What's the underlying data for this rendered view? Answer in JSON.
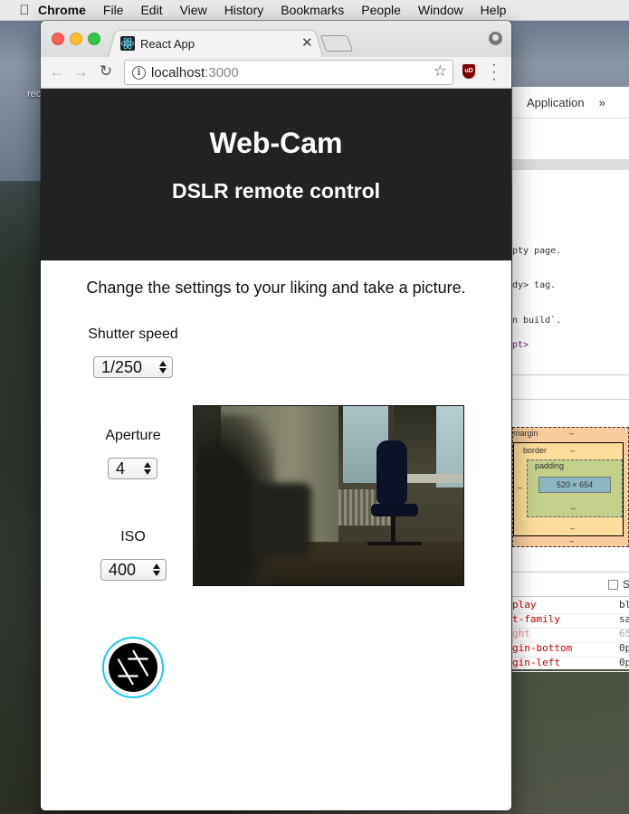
{
  "menubar": {
    "app": "Chrome",
    "items": [
      "File",
      "Edit",
      "View",
      "History",
      "Bookmarks",
      "People",
      "Window",
      "Help"
    ]
  },
  "desktop": {
    "cutoff_label": "rec"
  },
  "devtools": {
    "tab_label": "Application",
    "overflow": "»",
    "code_lines": [
      "pty page.",
      "dy> tag.",
      "n build`.",
      "pt>"
    ],
    "box_model": {
      "margin_label": "margin",
      "border_label": "border",
      "padding_label": "padding",
      "content_size": "520 × 654",
      "dash": "–"
    },
    "styles_checkbox_label": "S",
    "styles": [
      {
        "prop": "play",
        "val": "bl"
      },
      {
        "prop": "t-family",
        "val": "sa"
      },
      {
        "prop": "ght",
        "val": "65"
      },
      {
        "prop": "gin-bottom",
        "val": "0p"
      },
      {
        "prop": "gin-left",
        "val": "0p"
      }
    ]
  },
  "browser": {
    "tab_title": "React App",
    "url_host": "localhost",
    "url_port": ":3000",
    "ublock_label": "uD"
  },
  "page": {
    "title": "Web-Cam",
    "subtitle": "DSLR remote control",
    "intro": "Change the settings to your liking and take a picture.",
    "shutter_speed": {
      "label": "Shutter speed",
      "value": "1/250"
    },
    "aperture": {
      "label": "Aperture",
      "value": "4"
    },
    "iso": {
      "label": "ISO",
      "value": "400"
    }
  },
  "colors": {
    "header_bg": "#222222",
    "shutter_ring": "#1fc7eb",
    "react_logo": "#61dafb"
  }
}
